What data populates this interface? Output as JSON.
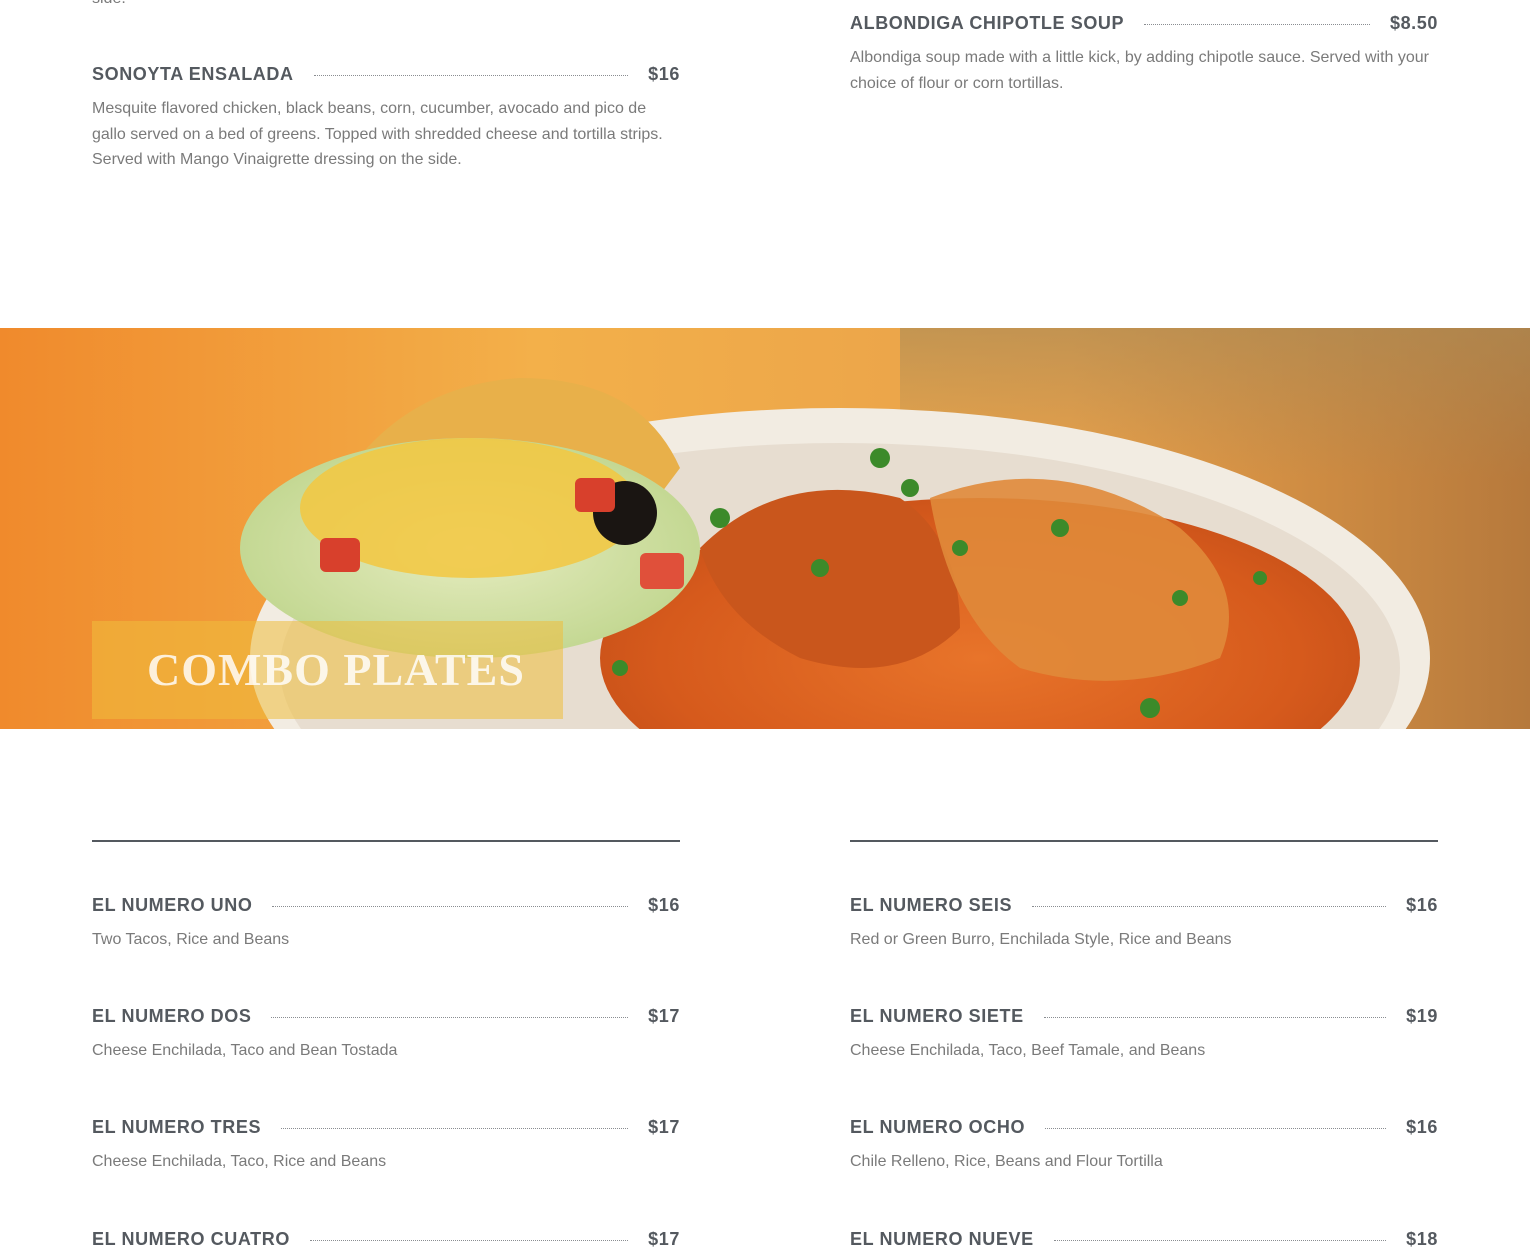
{
  "top_section": {
    "cut_text": "side.",
    "left_items": [
      {
        "name": "SONOYTA ENSALADA",
        "price": "$16",
        "description": "Mesquite flavored chicken, black beans, corn, cucumber, avocado and pico de gallo served on a bed of greens. Topped with shredded cheese and tortilla strips. Served with Mango Vinaigrette dressing on the side."
      }
    ],
    "right_items": [
      {
        "name": "ALBONDIGA CHIPOTLE SOUP",
        "price": "$8.50",
        "description": "Albondiga soup made with a little kick, by adding chipotle sauce. Served with your choice of flour or corn tortillas."
      }
    ]
  },
  "banner": {
    "title": "COMBO PLATES",
    "image_icon": "enchilada-plate-photo"
  },
  "combo_section": {
    "left_items": [
      {
        "name": "EL NUMERO UNO",
        "price": "$16",
        "description": "Two Tacos, Rice and Beans"
      },
      {
        "name": "EL NUMERO DOS",
        "price": "$17",
        "description": "Cheese Enchilada, Taco and Bean Tostada"
      },
      {
        "name": "EL NUMERO TRES",
        "price": "$17",
        "description": "Cheese Enchilada, Taco, Rice and Beans"
      },
      {
        "name": "EL NUMERO CUATRO",
        "price": "$17",
        "description": ""
      }
    ],
    "right_items": [
      {
        "name": "EL NUMERO SEIS",
        "price": "$16",
        "description": "Red or Green Burro, Enchilada Style, Rice and Beans"
      },
      {
        "name": "EL NUMERO SIETE",
        "price": "$19",
        "description": "Cheese Enchilada, Taco, Beef Tamale, and Beans"
      },
      {
        "name": "EL NUMERO OCHO",
        "price": "$16",
        "description": "Chile Relleno, Rice, Beans and Flour Tortilla"
      },
      {
        "name": "EL NUMERO NUEVE",
        "price": "$18",
        "description": ""
      }
    ]
  },
  "colors": {
    "heading": "#54595f",
    "body_text": "#7a7a7a",
    "banner_overlay": "#eebe3c"
  }
}
